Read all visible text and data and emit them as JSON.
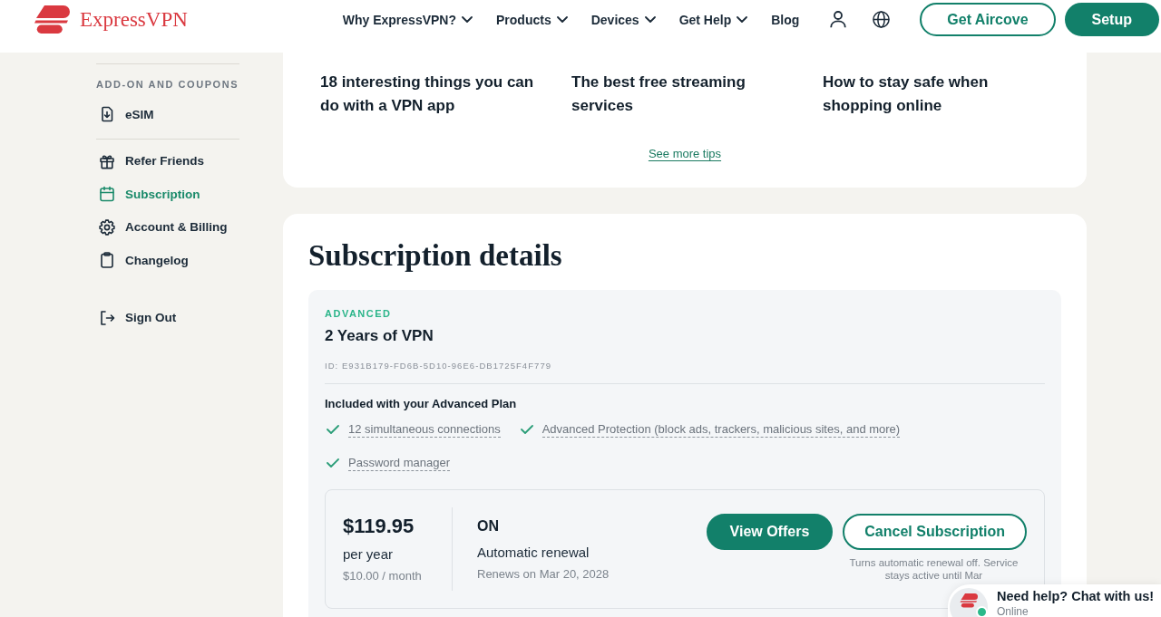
{
  "header": {
    "logo": "ExpressVPN",
    "nav": [
      {
        "label": "Why ExpressVPN?",
        "dropdown": true
      },
      {
        "label": "Products",
        "dropdown": true
      },
      {
        "label": "Devices",
        "dropdown": true
      },
      {
        "label": "Get Help",
        "dropdown": true
      },
      {
        "label": "Blog",
        "dropdown": false
      }
    ],
    "buttons": [
      {
        "label": "Get Aircove",
        "kind": "outline"
      },
      {
        "label": "Setup",
        "kind": "filled"
      }
    ]
  },
  "sidebar": {
    "groups": [
      {
        "heading": "ADD-ON AND COUPONS",
        "items": [
          {
            "label": "eSIM",
            "selected": false
          }
        ]
      },
      {
        "items": [
          {
            "label": "Refer Friends",
            "selected": false
          },
          {
            "label": "Subscription",
            "selected": true
          },
          {
            "label": "Account & Billing",
            "selected": false
          },
          {
            "label": "Changelog",
            "selected": false
          }
        ]
      },
      {
        "items": [
          {
            "label": "Sign Out",
            "selected": false
          }
        ]
      }
    ]
  },
  "tips": {
    "articles": [
      "18 interesting things you can do with a VPN app",
      "The best free streaming services",
      "How to stay safe when shopping online"
    ],
    "link": "See more tips"
  },
  "subscription": {
    "title": "Subscription details",
    "plan": {
      "tier": "ADVANCED",
      "name": "2 Years of VPN",
      "id": "ID: E931B179-FD6B-5D10-96E6-DB1725F4F779",
      "included_heading": "Included with your Advanced Plan",
      "features": [
        "12 simultaneous connections",
        "Advanced Protection (block ads, trackers, malicious sites, and more)",
        "Password manager"
      ]
    },
    "billing": {
      "price": "$119.95",
      "period": "per year",
      "monthly": "$10.00 / month",
      "renewal_status": "ON",
      "renewal_label": "Automatic renewal",
      "renews_on": "Renews on Mar 20, 2028",
      "buttons": [
        {
          "label": "View Offers",
          "kind": "filled"
        },
        {
          "label": "Cancel Subscription",
          "kind": "outline"
        }
      ],
      "note": "Turns automatic renewal off. Service stays active until Mar"
    }
  },
  "chat": {
    "title": "Need help? Chat with us!",
    "status": "Online",
    "online": true
  }
}
